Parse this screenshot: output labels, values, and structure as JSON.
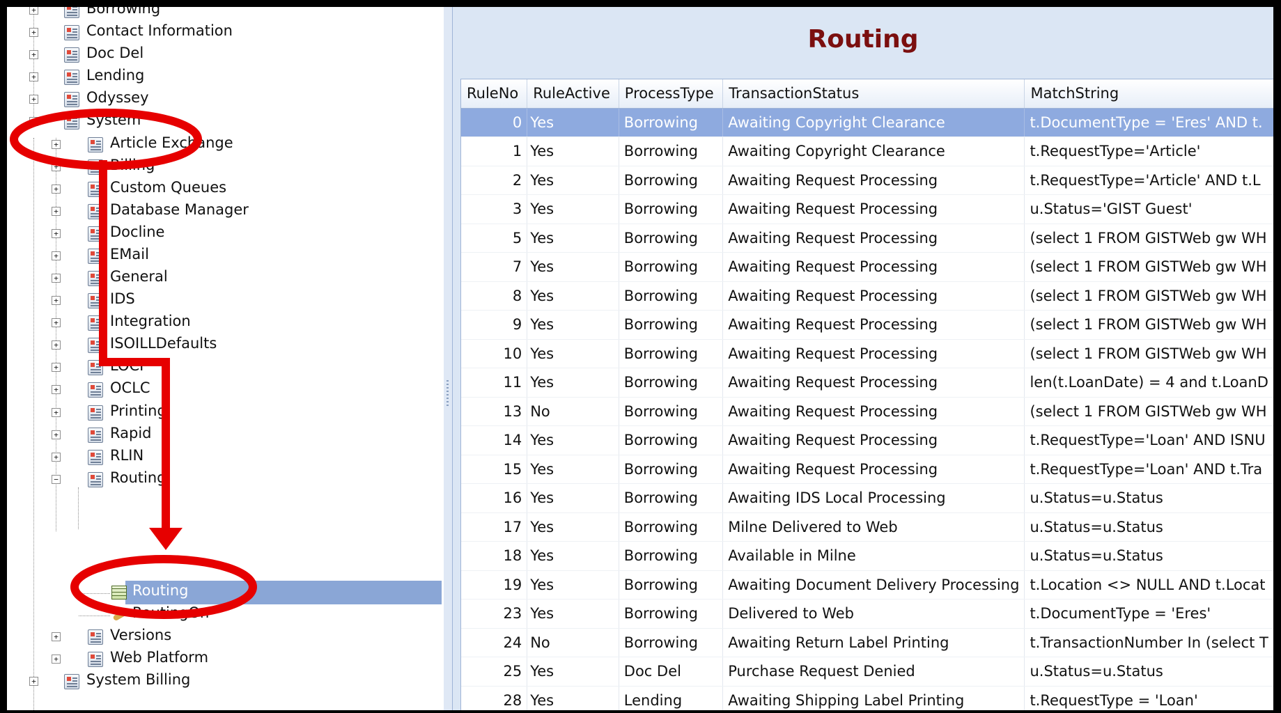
{
  "tree": {
    "top_items": [
      {
        "label": "Borrowing"
      },
      {
        "label": "Contact Information"
      },
      {
        "label": "Doc Del"
      },
      {
        "label": "Lending"
      },
      {
        "label": "Odyssey"
      },
      {
        "label": "System"
      }
    ],
    "system_children": [
      {
        "label": "Article Exchange"
      },
      {
        "label": "Billing"
      },
      {
        "label": "Custom Queues"
      },
      {
        "label": "Database Manager"
      },
      {
        "label": "Docline"
      },
      {
        "label": "EMail"
      },
      {
        "label": "General"
      },
      {
        "label": "IDS"
      },
      {
        "label": "Integration"
      },
      {
        "label": "ISOILLDefaults"
      },
      {
        "label": "LOCI"
      },
      {
        "label": "OCLC"
      },
      {
        "label": "Printing"
      },
      {
        "label": "Rapid"
      },
      {
        "label": "RLIN"
      },
      {
        "label": "Routing"
      }
    ],
    "routing_children": [
      {
        "label": "Routing"
      },
      {
        "label": "RoutingOn"
      }
    ],
    "after_items": [
      {
        "label": "Versions"
      },
      {
        "label": "Web Platform"
      }
    ],
    "bottom_items": [
      {
        "label": "System Billing"
      }
    ]
  },
  "panel": {
    "title": "Routing"
  },
  "grid": {
    "columns": [
      "RuleNo",
      "RuleActive",
      "ProcessType",
      "TransactionStatus",
      "MatchString"
    ],
    "rows": [
      [
        "0",
        "Yes",
        "Borrowing",
        "Awaiting Copyright Clearance",
        "t.DocumentType = 'Eres' AND t."
      ],
      [
        "1",
        "Yes",
        "Borrowing",
        "Awaiting Copyright Clearance",
        "t.RequestType='Article'"
      ],
      [
        "2",
        "Yes",
        "Borrowing",
        "Awaiting Request Processing",
        "t.RequestType='Article' AND t.L"
      ],
      [
        "3",
        "Yes",
        "Borrowing",
        "Awaiting Request Processing",
        "u.Status='GIST Guest'"
      ],
      [
        "5",
        "Yes",
        "Borrowing",
        "Awaiting Request Processing",
        "(select 1 FROM GISTWeb gw WH"
      ],
      [
        "7",
        "Yes",
        "Borrowing",
        "Awaiting Request Processing",
        "(select 1 FROM GISTWeb gw WH"
      ],
      [
        "8",
        "Yes",
        "Borrowing",
        "Awaiting Request Processing",
        "(select 1 FROM GISTWeb gw WH"
      ],
      [
        "9",
        "Yes",
        "Borrowing",
        "Awaiting Request Processing",
        "(select 1 FROM GISTWeb gw WH"
      ],
      [
        "10",
        "Yes",
        "Borrowing",
        "Awaiting Request Processing",
        "(select 1 FROM GISTWeb gw WH"
      ],
      [
        "11",
        "Yes",
        "Borrowing",
        "Awaiting Request Processing",
        "len(t.LoanDate) = 4 and t.LoanD"
      ],
      [
        "13",
        "No",
        "Borrowing",
        "Awaiting Request Processing",
        "(select 1 FROM GISTWeb gw WH"
      ],
      [
        "14",
        "Yes",
        "Borrowing",
        "Awaiting Request Processing",
        "t.RequestType='Loan' AND ISNU"
      ],
      [
        "15",
        "Yes",
        "Borrowing",
        "Awaiting Request Processing",
        "t.RequestType='Loan' AND t.Tra"
      ],
      [
        "16",
        "Yes",
        "Borrowing",
        "Awaiting IDS Local Processing",
        "u.Status=u.Status"
      ],
      [
        "17",
        "Yes",
        "Borrowing",
        "Milne Delivered to Web",
        "u.Status=u.Status"
      ],
      [
        "18",
        "Yes",
        "Borrowing",
        "Available in Milne",
        "u.Status=u.Status"
      ],
      [
        "19",
        "Yes",
        "Borrowing",
        "Awaiting Document Delivery Processing",
        "t.Location <> NULL AND t.Locat"
      ],
      [
        "23",
        "Yes",
        "Borrowing",
        "Delivered to Web",
        "t.DocumentType = 'Eres'"
      ],
      [
        "24",
        "No",
        "Borrowing",
        "Awaiting Return Label Printing",
        "t.TransactionNumber In (select T"
      ],
      [
        "25",
        "Yes",
        "Doc Del",
        "Purchase Request Denied",
        "u.Status=u.Status"
      ],
      [
        "28",
        "Yes",
        "Lending",
        "Awaiting Shipping Label Printing",
        "t.RequestType = 'Loan'"
      ]
    ],
    "selected_row_index": 0
  },
  "colors": {
    "title": "#7b0f0f",
    "selection": "#8eaadf",
    "annotation": "#e60000"
  }
}
